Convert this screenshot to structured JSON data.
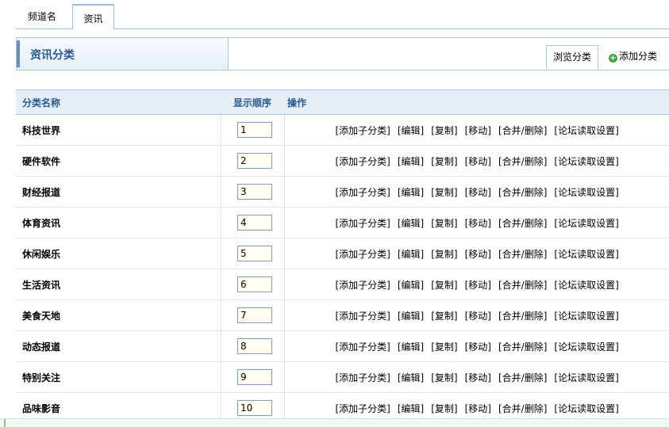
{
  "tabs": [
    {
      "label": "频道名"
    },
    {
      "label": "资讯"
    }
  ],
  "header": {
    "title": "资讯分类",
    "browse_label": "浏览分类",
    "add_label": "添加分类",
    "add_icon": "plus-icon"
  },
  "table": {
    "columns": [
      "分类名称",
      "显示顺序",
      "操作"
    ],
    "operations": [
      "[添加子分类]",
      "[编辑]",
      "[复制]",
      "[移动]",
      "[合并/删除]",
      "[论坛读取设置]"
    ],
    "rows": [
      {
        "name": "科技世界",
        "order": "1"
      },
      {
        "name": "硬件软件",
        "order": "2"
      },
      {
        "name": "财经报道",
        "order": "3"
      },
      {
        "name": "体育资讯",
        "order": "4"
      },
      {
        "name": "休闲娱乐",
        "order": "5"
      },
      {
        "name": "生活资讯",
        "order": "6"
      },
      {
        "name": "美食天地",
        "order": "7"
      },
      {
        "name": "动态报道",
        "order": "8"
      },
      {
        "name": "特别关注",
        "order": "9"
      },
      {
        "name": "品味影音",
        "order": "10"
      }
    ]
  },
  "colors": {
    "header_text": "#2a5a8c",
    "border": "#a9c9e0",
    "table_header_bg": "#e5eef7"
  }
}
